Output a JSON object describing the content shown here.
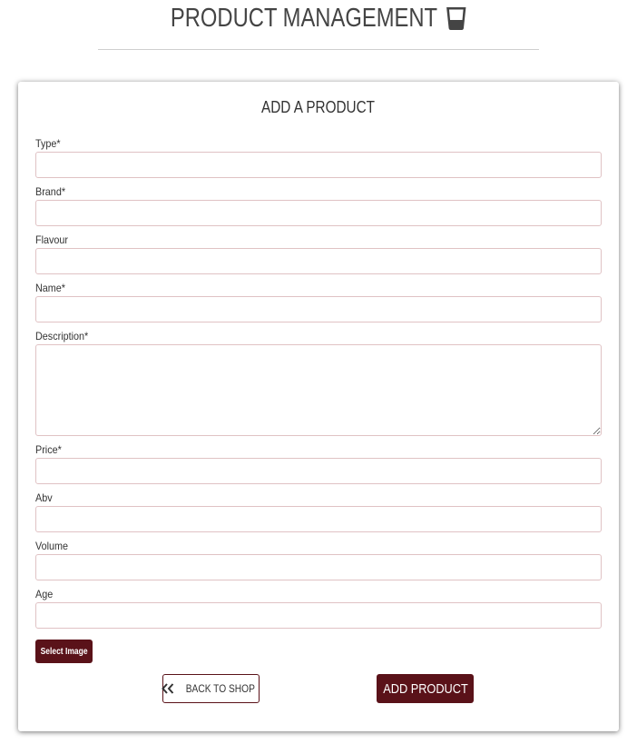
{
  "header": {
    "title": "PRODUCT MANAGEMENT",
    "icon": "whisky-glass-icon"
  },
  "form": {
    "title": "ADD A PRODUCT",
    "fields": [
      {
        "label": "Type*",
        "value": "",
        "placeholder": ""
      },
      {
        "label": "Brand*",
        "value": "",
        "placeholder": ""
      },
      {
        "label": "Flavour",
        "value": "",
        "placeholder": ""
      },
      {
        "label": "Name*",
        "value": "",
        "placeholder": ""
      },
      {
        "label": "Description*",
        "value": "",
        "placeholder": ""
      },
      {
        "label": "Price*",
        "value": "",
        "placeholder": ""
      },
      {
        "label": "Abv",
        "value": "",
        "placeholder": ""
      },
      {
        "label": "Volume",
        "value": "",
        "placeholder": ""
      },
      {
        "label": "Age",
        "value": "",
        "placeholder": ""
      }
    ],
    "select_image_label": "Select Image",
    "back_label": "BACK TO SHOP",
    "back_icon": "double-chevron-left-icon",
    "submit_label": "ADD PRODUCT"
  },
  "colors": {
    "accent": "#5a1219",
    "input_border": "#e0c2c4"
  }
}
